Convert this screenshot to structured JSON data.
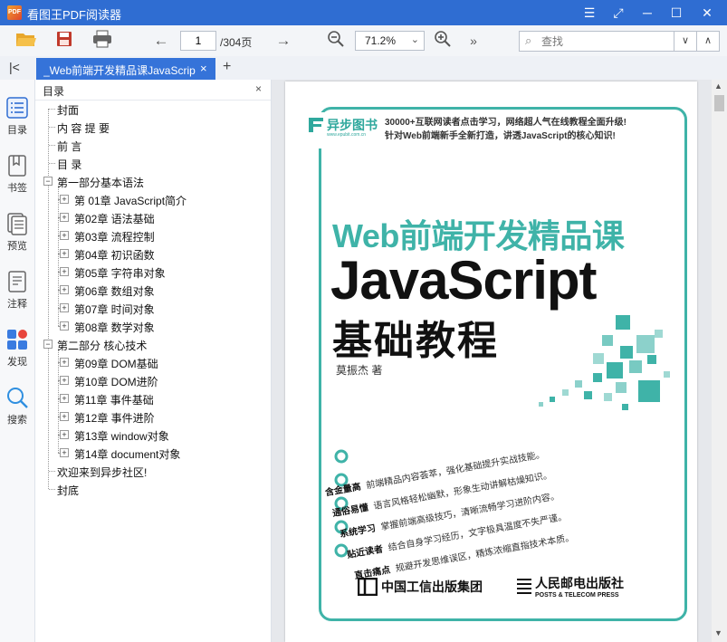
{
  "app": {
    "title": "看图王PDF阅读器",
    "logo_text": "PDF"
  },
  "toolbar": {
    "page_current": "1",
    "page_total": "/304页",
    "zoom": "71.2%",
    "more": "»",
    "search_placeholder": "查找"
  },
  "tab": {
    "label": "_Web前端开发精品课JavaScript基础教程",
    "close": "×",
    "new": "+"
  },
  "rail": [
    {
      "label": "目录",
      "icon": "outline-icon"
    },
    {
      "label": "书签",
      "icon": "bookmark-icon"
    },
    {
      "label": "预览",
      "icon": "thumbnails-icon"
    },
    {
      "label": "注释",
      "icon": "annotation-icon"
    },
    {
      "label": "发现",
      "icon": "discover-icon"
    },
    {
      "label": "搜索",
      "icon": "search-icon"
    }
  ],
  "panel": {
    "title": "目录",
    "close": "×"
  },
  "outline": [
    {
      "label": "封面",
      "level": 0
    },
    {
      "label": "内 容 提 要",
      "level": 0
    },
    {
      "label": "前 言",
      "level": 0
    },
    {
      "label": "目 录",
      "level": 0
    },
    {
      "label": "第一部分基本语法",
      "level": 0,
      "expanded": true
    },
    {
      "label": "第 01章 JavaScript简介",
      "level": 1
    },
    {
      "label": "第02章 语法基础",
      "level": 1
    },
    {
      "label": "第03章 流程控制",
      "level": 1
    },
    {
      "label": "第04章 初识函数",
      "level": 1
    },
    {
      "label": "第05章 字符串对象",
      "level": 1
    },
    {
      "label": "第06章 数组对象",
      "level": 1
    },
    {
      "label": "第07章 时间对象",
      "level": 1
    },
    {
      "label": "第08章 数学对象",
      "level": 1
    },
    {
      "label": "第二部分 核心技术",
      "level": 0,
      "expanded": true
    },
    {
      "label": "第09章 DOM基础",
      "level": 1
    },
    {
      "label": "第10章 DOM进阶",
      "level": 1
    },
    {
      "label": "第11章 事件基础",
      "level": 1
    },
    {
      "label": "第12章 事件进阶",
      "level": 1
    },
    {
      "label": "第13章 window对象",
      "level": 1
    },
    {
      "label": "第14章 document对象",
      "level": 1
    },
    {
      "label": "欢迎来到异步社区!",
      "level": 0
    },
    {
      "label": "封底",
      "level": 0
    }
  ],
  "cover": {
    "brand": "异步图书",
    "brand_url": "www.epubit.com.cn",
    "tagline1": "30000+互联网读者点击学习，网络超人气在线教程全面升级!",
    "tagline2": "针对Web前端新手全新打造，讲透JavaScript的核心知识!",
    "subtitle": "Web前端开发精品课",
    "title1": "JavaScript",
    "title2": "基础教程",
    "author": "莫振杰  著",
    "features": [
      {
        "key": "含金量高",
        "text": "前端精品内容荟萃，强化基础提升实战技能。"
      },
      {
        "key": "通俗易懂",
        "text": "语言风格轻松幽默，形象生动讲解枯燥知识。"
      },
      {
        "key": "系统学习",
        "text": "掌握前端高级技巧，清晰流畅学习进阶内容。"
      },
      {
        "key": "贴近读者",
        "text": "结合自身学习经历，文字极具温度不失严谨。"
      },
      {
        "key": "直击痛点",
        "text": "规避开发思维误区，精炼浓缩直指技术本质。"
      }
    ],
    "publisher1": "中国工信出版集团",
    "publisher2_cn": "人民邮电出版社",
    "publisher2_en": "POSTS & TELECOM PRESS"
  },
  "colors": {
    "titlebar": "#2f6dd2",
    "tab_active": "#3573d9",
    "cover_accent": "#3fb3a8"
  }
}
